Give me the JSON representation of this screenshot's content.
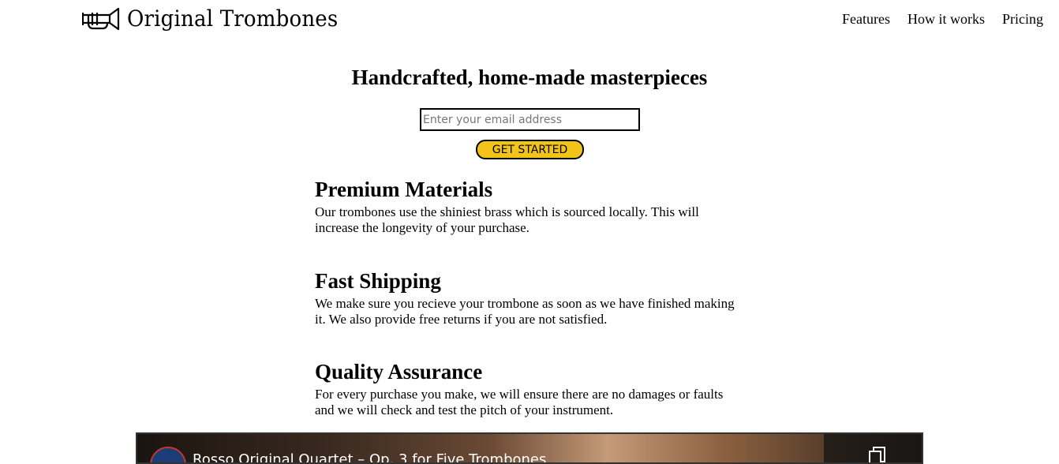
{
  "header": {
    "brand": "Original Trombones",
    "logo_icon": "trombone-icon",
    "nav": [
      {
        "label": "Features"
      },
      {
        "label": "How it works"
      },
      {
        "label": "Pricing"
      }
    ]
  },
  "hero": {
    "title": "Handcrafted, home-made masterpieces",
    "email_placeholder": "Enter your email address",
    "email_value": "",
    "cta_label": "GET STARTED"
  },
  "features": [
    {
      "title": "Premium Materials",
      "text": "Our trombones use the shiniest brass which is sourced locally. This will increase the longevity of your purchase."
    },
    {
      "title": "Fast Shipping",
      "text": "We make sure you recieve your trombone as soon as we have finished making it. We also provide free returns if you are not satisfied."
    },
    {
      "title": "Quality Assurance",
      "text": "For every purchase you make, we will ensure there are no damages or faults and we will check and test the pitch of your instrument."
    }
  ],
  "video": {
    "title": "Rosso Original Quartet – Op. 3 for Five Trombones",
    "copy_icon": "copy-link-icon"
  },
  "colors": {
    "cta_background": "#f2c318",
    "text": "#000000",
    "background": "#ffffff"
  }
}
